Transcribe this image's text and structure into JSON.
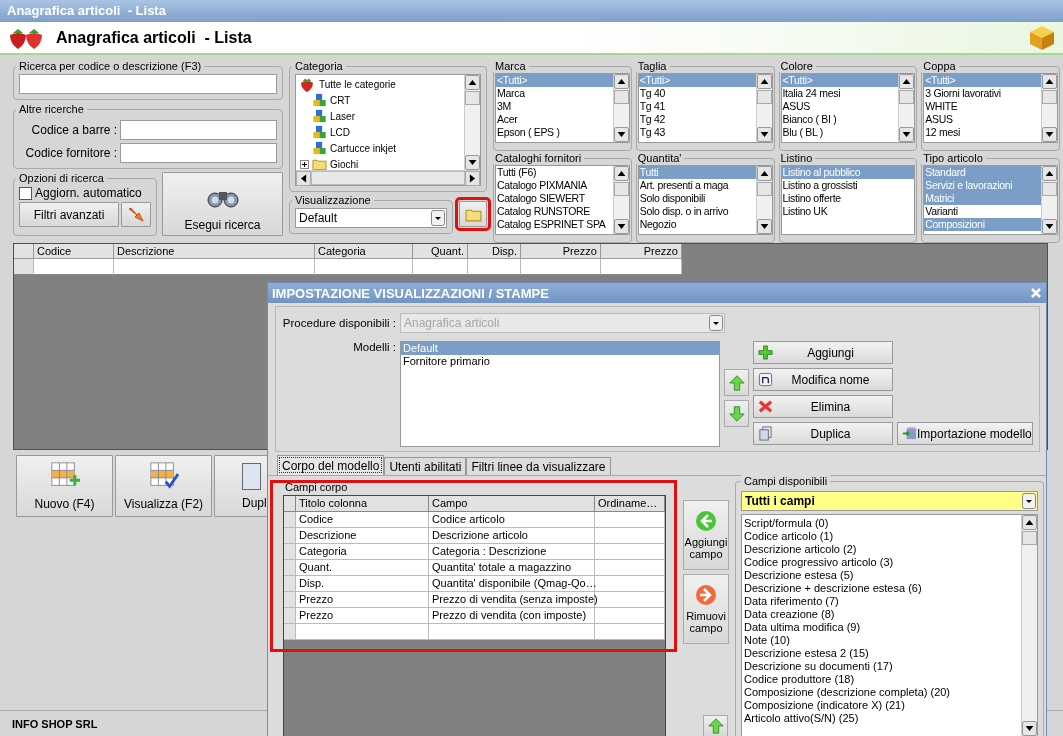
{
  "window": {
    "title": "Anagrafica articoli  - Lista"
  },
  "header": {
    "title": "Anagrafica articoli  - Lista"
  },
  "search": {
    "label": "Ricerca per codice o descrizione (F3)"
  },
  "other_searches": {
    "label": "Altre ricerche",
    "fields": [
      {
        "label": "Codice a barre :"
      },
      {
        "label": "Codice fornitore :"
      }
    ]
  },
  "search_options": {
    "label": "Opzioni di ricerca",
    "auto_update": {
      "label": "Aggiorn. automatico",
      "checked": false
    },
    "advanced_filters": "Filtri avanzati"
  },
  "run_search": "Esegui ricerca",
  "category": {
    "label": "Categoria",
    "tree": [
      {
        "text": "Tutte le categorie",
        "kind": "root",
        "expanded": true,
        "children": [
          {
            "text": "CRT",
            "kind": "category"
          },
          {
            "text": "Laser",
            "kind": "category"
          },
          {
            "text": "LCD",
            "kind": "category"
          },
          {
            "text": "Cartucce inkjet",
            "kind": "category"
          },
          {
            "text": "Giochi",
            "kind": "folder",
            "expanded": false
          }
        ]
      }
    ]
  },
  "view": {
    "label": "Visualizzazione",
    "value": "Default",
    "folder_highlighted": true
  },
  "filters": [
    {
      "label": "Marca",
      "items": [
        {
          "text": "<Tutti>",
          "selected": true
        },
        {
          "text": "Marca",
          "selected": false
        },
        {
          "text": "3M",
          "selected": false
        },
        {
          "text": "Acer",
          "selected": false
        },
        {
          "text": "Epson ( EPS )",
          "selected": false
        }
      ]
    },
    {
      "label": "Taglia",
      "items": [
        {
          "text": "<Tutti>",
          "selected": true
        },
        {
          "text": "Tg 40",
          "selected": false
        },
        {
          "text": "Tg 41",
          "selected": false
        },
        {
          "text": "Tg 42",
          "selected": false
        },
        {
          "text": "Tg 43",
          "selected": false
        }
      ]
    },
    {
      "label": "Colore",
      "items": [
        {
          "text": "<Tutti>",
          "selected": true
        },
        {
          "text": "Italia 24 mesi",
          "selected": false
        },
        {
          "text": "ASUS",
          "selected": false
        },
        {
          "text": "Bianco ( BI )",
          "selected": false
        },
        {
          "text": "Blu ( BL )",
          "selected": false
        }
      ]
    },
    {
      "label": "Coppa",
      "items": [
        {
          "text": "<Tutti>",
          "selected": true
        },
        {
          "text": "3 Giorni lavorativi",
          "selected": false
        },
        {
          "text": "WHITE",
          "selected": false
        },
        {
          "text": "ASUS",
          "selected": false
        },
        {
          "text": "12 mesi",
          "selected": false
        }
      ]
    },
    {
      "label": "Cataloghi fornitori",
      "items": [
        {
          "text": "Tutti (F6)",
          "selected": false
        },
        {
          "text": "Catalogo PIXMANIA",
          "selected": false
        },
        {
          "text": "Catalogo SIEWERT",
          "selected": false
        },
        {
          "text": "Catalog RUNSTORE",
          "selected": false
        },
        {
          "text": "Catalog ESPRINET SPA",
          "selected": false
        }
      ]
    },
    {
      "label": "Quantita'",
      "items": [
        {
          "text": "Tutti",
          "selected": true
        },
        {
          "text": "Art. presenti a maga",
          "selected": false
        },
        {
          "text": "Solo disponibili",
          "selected": false
        },
        {
          "text": "Solo disp. o in arrivo",
          "selected": false
        },
        {
          "text": "Negozio",
          "selected": false
        }
      ]
    },
    {
      "label": "Listino",
      "items": [
        {
          "text": "Listino al pubblico",
          "selected": true
        },
        {
          "text": "Listino a grossisti",
          "selected": false
        },
        {
          "text": "Listino offerte",
          "selected": false
        },
        {
          "text": "Listino UK",
          "selected": false
        }
      ]
    },
    {
      "label": "Tipo articolo",
      "items": [
        {
          "text": "Standard",
          "selected": true
        },
        {
          "text": "Servizi e lavorazioni",
          "selected": true
        },
        {
          "text": "Matrici",
          "selected": true
        },
        {
          "text": "Varianti",
          "selected": false
        },
        {
          "text": "Composizioni",
          "selected": true
        }
      ]
    }
  ],
  "results_table": {
    "columns": [
      {
        "label": "Codice",
        "numeric": false
      },
      {
        "label": "Descrizione",
        "numeric": false
      },
      {
        "label": "Categoria",
        "numeric": false
      },
      {
        "label": "Quant.",
        "numeric": true
      },
      {
        "label": "Disp.",
        "numeric": true
      },
      {
        "label": "Prezzo",
        "numeric": true
      },
      {
        "label": "Prezzo",
        "numeric": true
      }
    ]
  },
  "actions": [
    {
      "label": "Nuovo (F4)",
      "kind": "new"
    },
    {
      "label": "Visualizza (F2)",
      "kind": "view"
    },
    {
      "label": "Dupl",
      "kind": "duplicate"
    }
  ],
  "status_bar": {
    "company": "INFO SHOP SRL"
  },
  "dialog": {
    "title": "IMPOSTAZIONE VISUALIZZAZIONI / STAMPE",
    "procedures": {
      "label": "Procedure disponibili :",
      "value": "Anagrafica articoli",
      "disabled": true
    },
    "models": {
      "label": "Modelli :",
      "items": [
        {
          "text": "Default",
          "selected": true
        },
        {
          "text": "Fornitore primario",
          "selected": false
        }
      ]
    },
    "model_buttons": [
      {
        "label": "Aggiungi",
        "kind": "add"
      },
      {
        "label": "Modifica nome",
        "kind": "rename"
      },
      {
        "label": "Elimina",
        "kind": "delete"
      },
      {
        "label": "Duplica",
        "kind": "duplicate"
      },
      {
        "label": "Importazione modello",
        "kind": "import"
      }
    ],
    "tabs": [
      {
        "label": "Corpo del modello",
        "selected": true
      },
      {
        "label": "Utenti abilitati",
        "selected": false
      },
      {
        "label": "Filtri linee da visualizzare",
        "selected": false
      }
    ],
    "body_fields": {
      "label": "Campi corpo",
      "highlighted": true,
      "columns": [
        "Titolo colonna",
        "Campo",
        "Ordiname…"
      ],
      "rows": [
        {
          "title": "Codice",
          "field": "Codice articolo"
        },
        {
          "title": "Descrizione",
          "field": "Descrizione articolo"
        },
        {
          "title": "Categoria",
          "field": "Categoria : Descrizione"
        },
        {
          "title": "Quant.",
          "field": "Quantita' totale a magazzino"
        },
        {
          "title": "Disp.",
          "field": "Quantita' disponibile (Qmag-Qo…"
        },
        {
          "title": "Prezzo",
          "field": "Prezzo di vendita (senza imposte)"
        },
        {
          "title": "Prezzo",
          "field": "Prezzo di vendita (con imposte)"
        }
      ]
    },
    "field_buttons": [
      {
        "label": "Aggiungi campo",
        "kind": "add"
      },
      {
        "label": "Rimuovi campo",
        "kind": "remove"
      }
    ],
    "available_fields": {
      "label": "Campi disponibili",
      "filter": "Tutti i campi",
      "items": [
        "Script/formula (0)",
        "Codice articolo (1)",
        "Descrizione articolo (2)",
        "Codice progressivo articolo (3)",
        "Descrizione estesa (5)",
        "Descrizione + descrizione estesa (6)",
        "Data riferimento (7)",
        "Data creazione (8)",
        "Data ultima modifica (9)",
        "Note (10)",
        "Descrizione estesa 2 (15)",
        "Descrizione su documenti (17)",
        "Codice produttore (18)",
        "Composizione (descrizione completa) (20)",
        "Composizione (indicatore X) (21)",
        "Articolo attivo(S/N) (25)"
      ]
    }
  }
}
